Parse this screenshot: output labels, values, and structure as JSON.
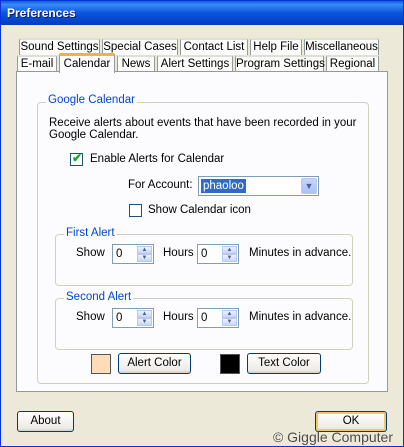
{
  "window": {
    "title": "Preferences"
  },
  "tabs_back": [
    "Sound Settings",
    "Special Cases",
    "Contact List",
    "Help File",
    "Miscellaneous"
  ],
  "tabs_front": [
    "E-mail",
    "Calendar",
    "News",
    "Alert Settings",
    "Program Settings",
    "Regional"
  ],
  "active_tab": "Calendar",
  "google_calendar": {
    "legend": "Google Calendar",
    "description_line1": "Receive alerts about events that have been recorded in your",
    "description_line2": "Google Calendar.",
    "enable_label": "Enable Alerts for Calendar",
    "enable_checked": true,
    "account_label": "For Account:",
    "account_value": "phaoloo",
    "show_icon_label": "Show Calendar icon",
    "show_icon_checked": false
  },
  "first_alert": {
    "legend": "First Alert",
    "show_label": "Show",
    "hours_value": "0",
    "hours_label": "Hours",
    "minutes_value": "0",
    "minutes_label": "Minutes in advance."
  },
  "second_alert": {
    "legend": "Second Alert",
    "show_label": "Show",
    "hours_value": "0",
    "hours_label": "Hours",
    "minutes_value": "0",
    "minutes_label": "Minutes in advance."
  },
  "colors": {
    "alert_color_label": "Alert Color",
    "alert_color_value": "#ffdcb8",
    "text_color_label": "Text Color",
    "text_color_value": "#000000"
  },
  "footer": {
    "about_label": "About",
    "ok_label": "OK",
    "watermark": "© Giggle Computer"
  }
}
